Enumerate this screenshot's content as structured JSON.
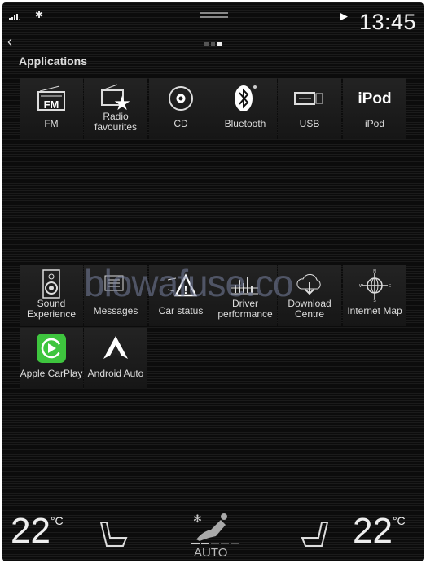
{
  "status_bar": {
    "time": "13:45",
    "signal_icon": "signal-strength-icon",
    "bluetooth_icon": "bluetooth-icon",
    "play_icon": "play-icon"
  },
  "nav": {
    "back_icon": "chevron-left-icon",
    "pages": 3,
    "active_page": 3
  },
  "section_title": "Applications",
  "apps": [
    {
      "label": "FM",
      "icon": "fm-radio-icon"
    },
    {
      "label": "Radio favourites",
      "icon": "radio-star-icon"
    },
    {
      "label": "CD",
      "icon": "cd-icon"
    },
    {
      "label": "Bluetooth",
      "icon": "bluetooth-icon"
    },
    {
      "label": "USB",
      "icon": "usb-icon"
    },
    {
      "label": "iPod",
      "icon": "ipod-icon",
      "icon_text": "iPod"
    },
    {
      "label": "Sound Experience",
      "icon": "speaker-icon"
    },
    {
      "label": "Messages",
      "icon": "messages-icon"
    },
    {
      "label": "Car status",
      "icon": "car-warning-icon"
    },
    {
      "label": "Driver performance",
      "icon": "bar-chart-icon"
    },
    {
      "label": "Download Centre",
      "icon": "cloud-download-icon"
    },
    {
      "label": "Internet Map",
      "icon": "compass-globe-icon"
    },
    {
      "label": "Apple CarPlay",
      "icon": "carplay-icon",
      "color": "#3ec53e"
    },
    {
      "label": "Android Auto",
      "icon": "android-auto-icon"
    }
  ],
  "climate": {
    "left_temp": "22",
    "right_temp": "22",
    "unit": "°C",
    "mode": "AUTO",
    "fan_level": 2,
    "fan_max": 5
  },
  "watermark": "blowafuse.co"
}
